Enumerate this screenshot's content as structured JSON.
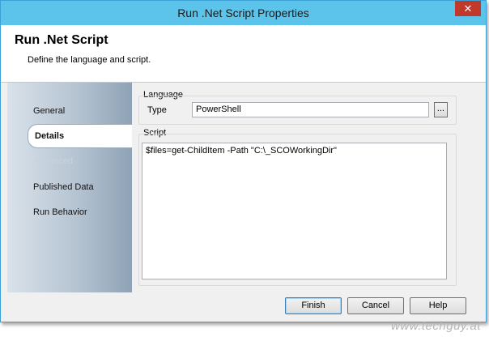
{
  "window": {
    "title": "Run .Net Script Properties",
    "close_glyph": "✕"
  },
  "header": {
    "title": "Run .Net Script",
    "subtitle": "Define the language and script."
  },
  "nav": {
    "items": [
      {
        "label": "General",
        "state": "normal"
      },
      {
        "label": "Details",
        "state": "selected"
      },
      {
        "label": "Advanced",
        "state": "disabled"
      },
      {
        "label": "Published Data",
        "state": "normal"
      },
      {
        "label": "Run Behavior",
        "state": "normal"
      }
    ]
  },
  "language": {
    "group_label": "Language",
    "type_label": "Type",
    "type_value": "PowerShell",
    "browse_label": "..."
  },
  "script": {
    "group_label": "Script",
    "content": "$files=get-ChildItem -Path \"C:\\_SCOWorkingDir\""
  },
  "buttons": {
    "finish": "Finish",
    "cancel": "Cancel",
    "help": "Help"
  },
  "watermark": "www.techguy.at"
}
